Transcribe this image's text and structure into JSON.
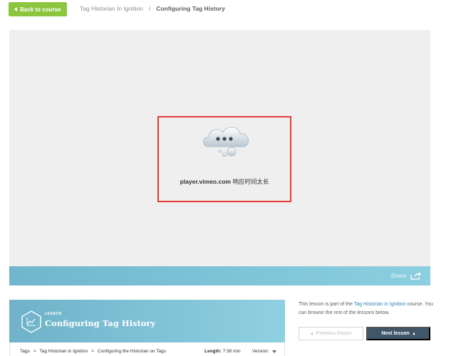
{
  "topbar": {
    "back_label": "Back to course",
    "breadcrumb": [
      "Tag Historian In Ignition",
      "/",
      "Configuring Tag History"
    ]
  },
  "player": {
    "error_host": "player.vimeo.com",
    "error_message": "响应时间太长",
    "share_label": "Share"
  },
  "lesson": {
    "tag": "LESSON",
    "title": "Configuring Tag History",
    "path": [
      "Tags",
      ">",
      "Tag Historian in Ignition",
      ">",
      "Configuring the Historian on Tags"
    ],
    "length_label": "Length:",
    "length_value": "7:38 min",
    "version_label": "Version:"
  },
  "sidebar": {
    "text_before": "This lesson is part of the ",
    "course_link": "Tag Historian in Ignition",
    "text_after": " course. You can browse the rest of the lessons below.",
    "prev_label": "Previous lesson",
    "next_label": "Next lesson"
  },
  "colors": {
    "accent_green": "#8cc63f",
    "error_red": "#e53935",
    "lesson_blue": "#7ec3d8",
    "next_button": "#3f5768"
  }
}
